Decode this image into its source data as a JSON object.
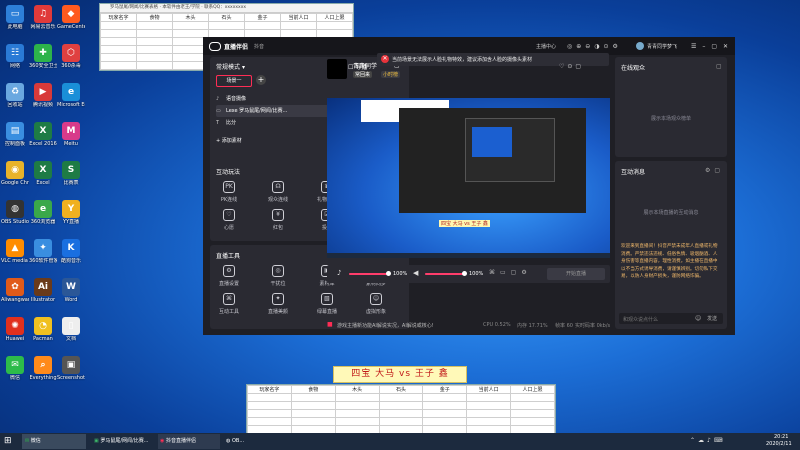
{
  "desktop_icons": [
    {
      "label": "此电脑",
      "icon": "computer-icon",
      "color": "#2d7fd8",
      "glyph": "▭"
    },
    {
      "label": "网易云音乐",
      "icon": "music-icon",
      "color": "#e03a3a",
      "glyph": "♫"
    },
    {
      "label": "GameCenter",
      "icon": "game-icon",
      "color": "#ff5a1f",
      "glyph": "◆"
    },
    {
      "label": "网络",
      "icon": "network-icon",
      "color": "#2a7ad6",
      "glyph": "☷"
    },
    {
      "label": "360安全卫士",
      "icon": "shield-icon",
      "color": "#2db34a",
      "glyph": "✚"
    },
    {
      "label": "360杀毒",
      "icon": "antivirus-icon",
      "color": "#e04040",
      "glyph": "⬡"
    },
    {
      "label": "回收站",
      "icon": "recycle-icon",
      "color": "#6aa8e0",
      "glyph": "♻"
    },
    {
      "label": "腾讯视频",
      "icon": "video-icon",
      "color": "#d83a3a",
      "glyph": "▶"
    },
    {
      "label": "Microsoft Edge",
      "icon": "edge-icon",
      "color": "#1a8fd8",
      "glyph": "e"
    },
    {
      "label": "控制面板",
      "icon": "control-panel-icon",
      "color": "#3a8ee0",
      "glyph": "▤"
    },
    {
      "label": "Excel 2016",
      "icon": "excel-icon",
      "color": "#1e7b45",
      "glyph": "X"
    },
    {
      "label": "Meitu",
      "icon": "meitu-icon",
      "color": "#d83a8a",
      "glyph": "M"
    },
    {
      "label": "Google Chrome",
      "icon": "chrome-icon",
      "color": "#e8b32a",
      "glyph": "◉"
    },
    {
      "label": "Excel",
      "icon": "excel-icon",
      "color": "#1e7b45",
      "glyph": "X"
    },
    {
      "label": "比赛表",
      "icon": "sheet-icon",
      "color": "#1e7b45",
      "glyph": "S"
    },
    {
      "label": "OBS Studio",
      "icon": "obs-icon",
      "color": "#333",
      "glyph": "◍"
    },
    {
      "label": "360浏览器",
      "icon": "browser-icon",
      "color": "#3aa84a",
      "glyph": "e"
    },
    {
      "label": "YY直播",
      "icon": "yy-icon",
      "color": "#f0b020",
      "glyph": "Y"
    },
    {
      "label": "VLC media player",
      "icon": "vlc-icon",
      "color": "#ff8c00",
      "glyph": "▲"
    },
    {
      "label": "360软件管家",
      "icon": "software-icon",
      "color": "#3a8ee0",
      "glyph": "✦"
    },
    {
      "label": "酷狗音乐",
      "icon": "kugou-icon",
      "color": "#1a6fe0",
      "glyph": "K"
    },
    {
      "label": "Aliwangwang",
      "icon": "chat-icon",
      "color": "#e05a1a",
      "glyph": "✿"
    },
    {
      "label": "Illustrator",
      "icon": "illustrator-icon",
      "color": "#6a3a1a",
      "glyph": "Ai"
    },
    {
      "label": "Word",
      "icon": "word-icon",
      "color": "#2b5797",
      "glyph": "W"
    },
    {
      "label": "Huawei",
      "icon": "huawei-icon",
      "color": "#e0301e",
      "glyph": "✺"
    },
    {
      "label": "Pacman",
      "icon": "pacman-icon",
      "color": "#f0c020",
      "glyph": "◔"
    },
    {
      "label": "文档",
      "icon": "document-icon",
      "color": "#eeeeee",
      "glyph": "▯"
    },
    {
      "label": "微信",
      "icon": "wechat-icon",
      "color": "#2dbb4a",
      "glyph": "✉"
    },
    {
      "label": "Everything",
      "icon": "search-icon",
      "color": "#ff8a1a",
      "glyph": "⌕"
    },
    {
      "label": "Screenshot",
      "icon": "image-icon",
      "color": "#555",
      "glyph": "▣"
    }
  ],
  "top_sheet": {
    "title_bar": "罗马鼠尾/网闻/比赛表格 · 本软件由老王/学院 · 联系QQ：xxxxxxxx",
    "headers": [
      "玩家名字",
      "食物",
      "木头",
      "石头",
      "金子",
      "当前人口",
      "人口上限"
    ]
  },
  "bottom_sheet": {
    "banner": "四宝 大马 vs 王子 鑫",
    "headers": [
      "玩家名字",
      "食物",
      "木头",
      "石头",
      "金子",
      "当前人口",
      "人口上限"
    ]
  },
  "live_window": {
    "app_name": "直播伴侣",
    "tab": "抖音",
    "warning": "当前场景无法展示人脸礼物特效，建议添加含人脸的摄像头素材",
    "user_name": "青青同学梦飞",
    "host_name": "青青同学",
    "tag1": "常回来",
    "tag2": "小时榜",
    "top_links": [
      "主播中心"
    ],
    "scene_mode_label": "常规模式",
    "guide_label": "导播",
    "scene_tab": "场景一",
    "sources": [
      {
        "label": "语音摄像",
        "icon": "mic-icon"
      },
      {
        "label": "Lexe 罗马鼠尾/网闻/比赛...",
        "icon": "window-icon"
      },
      {
        "label": "比分",
        "icon": "text-icon"
      }
    ],
    "add_source": "添加素材",
    "source_action": "提交",
    "interactive_title": "互动玩法",
    "interactive_more": "全部",
    "interactive_tools": [
      {
        "label": "PK连线",
        "glyph": "PK"
      },
      {
        "label": "观众连线",
        "glyph": "☊"
      },
      {
        "label": "礼物挑战",
        "glyph": "♛"
      },
      {
        "label": "福袋",
        "glyph": "✿"
      },
      {
        "label": "心愿",
        "glyph": "♡"
      },
      {
        "label": "红包",
        "glyph": "¥"
      },
      {
        "label": "投票",
        "glyph": "☑"
      },
      {
        "label": "礼物投票",
        "glyph": "▦"
      }
    ],
    "live_tools_title": "直播工具",
    "live_tools_more": "全部",
    "live_tools": [
      {
        "label": "直播设置",
        "glyph": "⚙"
      },
      {
        "label": "干扰位",
        "glyph": "◎"
      },
      {
        "label": "素材库",
        "glyph": "▣"
      },
      {
        "label": "素材同步",
        "glyph": "⇅"
      },
      {
        "label": "互动工具",
        "glyph": "⌘"
      },
      {
        "label": "直播美颜",
        "glyph": "✦"
      },
      {
        "label": "绿幕直播",
        "glyph": "▧"
      },
      {
        "label": "虚拟形象",
        "glyph": "☺"
      }
    ],
    "preview_text": "四宝 大马 vs 王子 鑫",
    "mic_level": 100,
    "speaker_level": 100,
    "mic_level_label": "100%",
    "speaker_level_label": "100%",
    "start_button": "开始直播",
    "status_notice": "游戏主播新功能AI解说实况，AI解说或核心!",
    "stats": {
      "cpu": "CPU 0.52%",
      "mem": "内存 17.71%",
      "fps": "帧率 60",
      "bitrate": "实时码率 0kb/s"
    },
    "audience_title": "在线观众",
    "audience_empty": "展示本场观众榜单",
    "messages_title": "互动消息",
    "messages_empty": "展示本场直播的互动消息",
    "welcome_text": "欢迎来到直播间！抖音严禁未成年人直播或礼物消费。严禁违法违规、低俗色情、吸烟酗酒、人身伤害等直播内容，理性消费。如主播在直播中以不当方式诱导消费，请谨慎辨别。切勿私下交易，以防人身财产损失，谨防网络诈骗。",
    "chat_placeholder": "和观众说点什么"
  },
  "taskbar": {
    "items": [
      "微信",
      "罗马鼠尾/网闻/比赛...",
      "抖音直播伴侣",
      "OB..."
    ],
    "time": "20:21",
    "date": "2020/2/11",
    "colors": {
      "accent": "#ff2d55",
      "warning": "#e8333b"
    }
  }
}
